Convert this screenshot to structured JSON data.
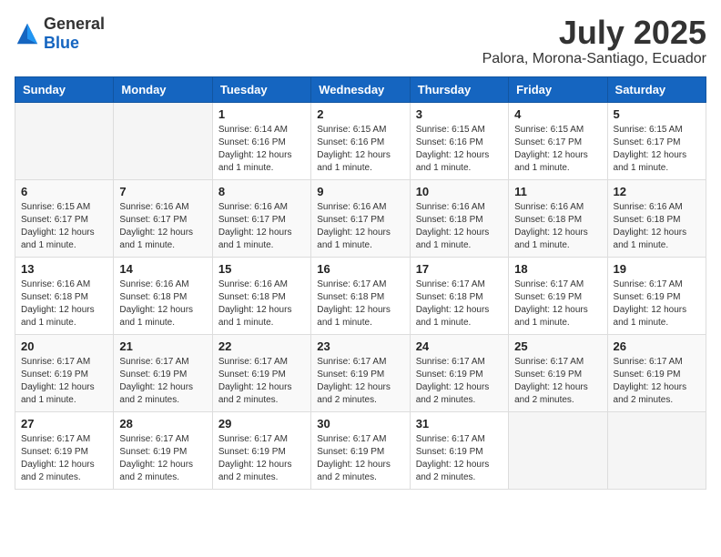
{
  "header": {
    "logo_general": "General",
    "logo_blue": "Blue",
    "month": "July 2025",
    "location": "Palora, Morona-Santiago, Ecuador"
  },
  "weekdays": [
    "Sunday",
    "Monday",
    "Tuesday",
    "Wednesday",
    "Thursday",
    "Friday",
    "Saturday"
  ],
  "weeks": [
    [
      {
        "day": "",
        "info": ""
      },
      {
        "day": "",
        "info": ""
      },
      {
        "day": "1",
        "info": "Sunrise: 6:14 AM\nSunset: 6:16 PM\nDaylight: 12 hours and 1 minute."
      },
      {
        "day": "2",
        "info": "Sunrise: 6:15 AM\nSunset: 6:16 PM\nDaylight: 12 hours and 1 minute."
      },
      {
        "day": "3",
        "info": "Sunrise: 6:15 AM\nSunset: 6:16 PM\nDaylight: 12 hours and 1 minute."
      },
      {
        "day": "4",
        "info": "Sunrise: 6:15 AM\nSunset: 6:17 PM\nDaylight: 12 hours and 1 minute."
      },
      {
        "day": "5",
        "info": "Sunrise: 6:15 AM\nSunset: 6:17 PM\nDaylight: 12 hours and 1 minute."
      }
    ],
    [
      {
        "day": "6",
        "info": "Sunrise: 6:15 AM\nSunset: 6:17 PM\nDaylight: 12 hours and 1 minute."
      },
      {
        "day": "7",
        "info": "Sunrise: 6:16 AM\nSunset: 6:17 PM\nDaylight: 12 hours and 1 minute."
      },
      {
        "day": "8",
        "info": "Sunrise: 6:16 AM\nSunset: 6:17 PM\nDaylight: 12 hours and 1 minute."
      },
      {
        "day": "9",
        "info": "Sunrise: 6:16 AM\nSunset: 6:17 PM\nDaylight: 12 hours and 1 minute."
      },
      {
        "day": "10",
        "info": "Sunrise: 6:16 AM\nSunset: 6:18 PM\nDaylight: 12 hours and 1 minute."
      },
      {
        "day": "11",
        "info": "Sunrise: 6:16 AM\nSunset: 6:18 PM\nDaylight: 12 hours and 1 minute."
      },
      {
        "day": "12",
        "info": "Sunrise: 6:16 AM\nSunset: 6:18 PM\nDaylight: 12 hours and 1 minute."
      }
    ],
    [
      {
        "day": "13",
        "info": "Sunrise: 6:16 AM\nSunset: 6:18 PM\nDaylight: 12 hours and 1 minute."
      },
      {
        "day": "14",
        "info": "Sunrise: 6:16 AM\nSunset: 6:18 PM\nDaylight: 12 hours and 1 minute."
      },
      {
        "day": "15",
        "info": "Sunrise: 6:16 AM\nSunset: 6:18 PM\nDaylight: 12 hours and 1 minute."
      },
      {
        "day": "16",
        "info": "Sunrise: 6:17 AM\nSunset: 6:18 PM\nDaylight: 12 hours and 1 minute."
      },
      {
        "day": "17",
        "info": "Sunrise: 6:17 AM\nSunset: 6:18 PM\nDaylight: 12 hours and 1 minute."
      },
      {
        "day": "18",
        "info": "Sunrise: 6:17 AM\nSunset: 6:19 PM\nDaylight: 12 hours and 1 minute."
      },
      {
        "day": "19",
        "info": "Sunrise: 6:17 AM\nSunset: 6:19 PM\nDaylight: 12 hours and 1 minute."
      }
    ],
    [
      {
        "day": "20",
        "info": "Sunrise: 6:17 AM\nSunset: 6:19 PM\nDaylight: 12 hours and 1 minute."
      },
      {
        "day": "21",
        "info": "Sunrise: 6:17 AM\nSunset: 6:19 PM\nDaylight: 12 hours and 2 minutes."
      },
      {
        "day": "22",
        "info": "Sunrise: 6:17 AM\nSunset: 6:19 PM\nDaylight: 12 hours and 2 minutes."
      },
      {
        "day": "23",
        "info": "Sunrise: 6:17 AM\nSunset: 6:19 PM\nDaylight: 12 hours and 2 minutes."
      },
      {
        "day": "24",
        "info": "Sunrise: 6:17 AM\nSunset: 6:19 PM\nDaylight: 12 hours and 2 minutes."
      },
      {
        "day": "25",
        "info": "Sunrise: 6:17 AM\nSunset: 6:19 PM\nDaylight: 12 hours and 2 minutes."
      },
      {
        "day": "26",
        "info": "Sunrise: 6:17 AM\nSunset: 6:19 PM\nDaylight: 12 hours and 2 minutes."
      }
    ],
    [
      {
        "day": "27",
        "info": "Sunrise: 6:17 AM\nSunset: 6:19 PM\nDaylight: 12 hours and 2 minutes."
      },
      {
        "day": "28",
        "info": "Sunrise: 6:17 AM\nSunset: 6:19 PM\nDaylight: 12 hours and 2 minutes."
      },
      {
        "day": "29",
        "info": "Sunrise: 6:17 AM\nSunset: 6:19 PM\nDaylight: 12 hours and 2 minutes."
      },
      {
        "day": "30",
        "info": "Sunrise: 6:17 AM\nSunset: 6:19 PM\nDaylight: 12 hours and 2 minutes."
      },
      {
        "day": "31",
        "info": "Sunrise: 6:17 AM\nSunset: 6:19 PM\nDaylight: 12 hours and 2 minutes."
      },
      {
        "day": "",
        "info": ""
      },
      {
        "day": "",
        "info": ""
      }
    ]
  ]
}
